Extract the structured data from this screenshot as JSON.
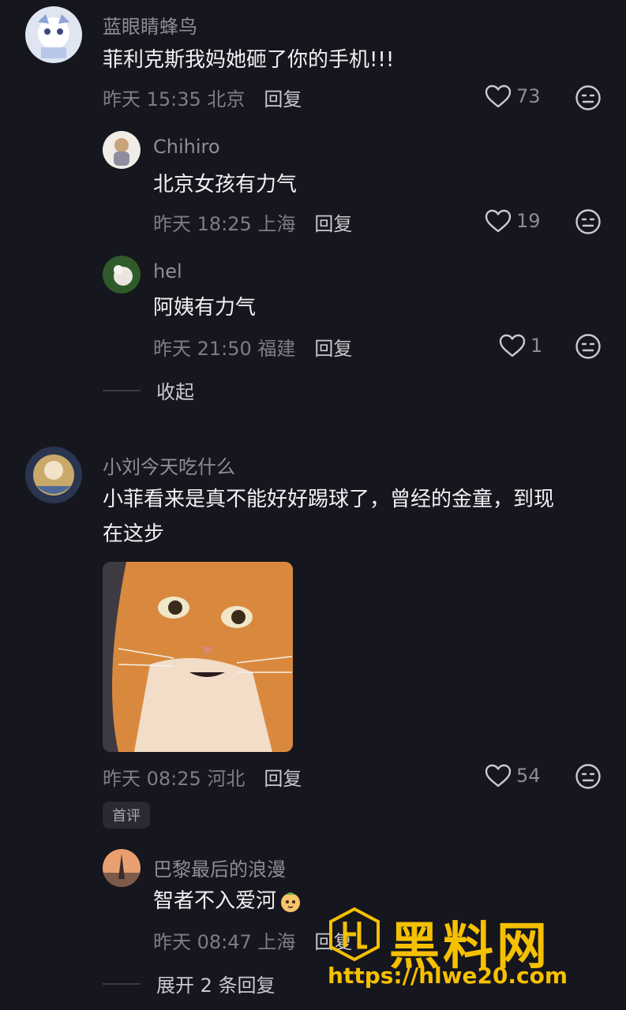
{
  "comments": [
    {
      "name": "蓝眼睛蜂鸟",
      "text": "菲利克斯我妈她砸了你的手机!!!",
      "time": "昨天 15:35 北京",
      "reply": "回复",
      "likes": "73",
      "replies": [
        {
          "name": "Chihiro",
          "text": "北京女孩有力气",
          "time": "昨天 18:25 上海",
          "reply": "回复",
          "likes": "19"
        },
        {
          "name": "hel",
          "text": "阿姨有力气",
          "time": "昨天 21:50 福建",
          "reply": "回复",
          "likes": "1"
        }
      ],
      "collapse_label": "收起"
    },
    {
      "name": "小刘今天吃什么",
      "text_line1": "小菲看来是真不能好好踢球了，曾经的金童，到现",
      "text_line2": "在这步",
      "time": "昨天 08:25 河北",
      "reply": "回复",
      "likes": "54",
      "badge": "首评",
      "replies": [
        {
          "name": "巴黎最后的浪漫",
          "text": "智者不入爱河",
          "time": "昨天 08:47 上海",
          "reply": "回复"
        }
      ],
      "expand_label": "展开 2 条回复"
    }
  ],
  "watermark": {
    "title": "黑料网",
    "url": "https://hlwe20.com"
  },
  "colors": {
    "background": "#16161e",
    "accent": "#f5c000"
  }
}
